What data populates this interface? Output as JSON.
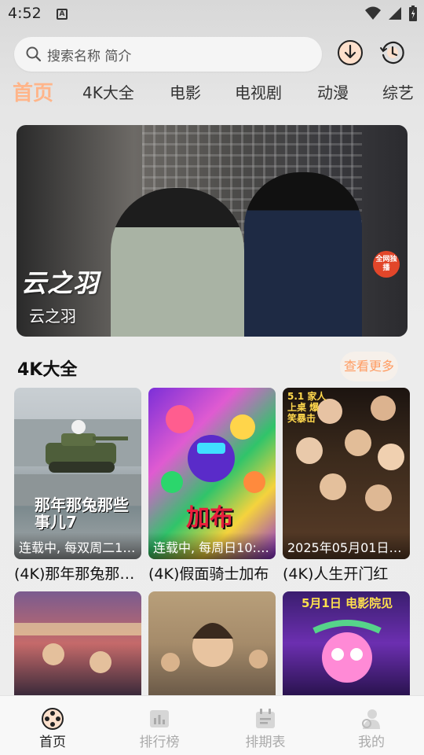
{
  "status_bar": {
    "time": "4:52",
    "notification_icon": "A"
  },
  "search": {
    "placeholder": "搜索名称 简介"
  },
  "header_icons": [
    "download-icon",
    "history-icon"
  ],
  "tabs": [
    {
      "label": "首页",
      "active": true
    },
    {
      "label": "4K大全"
    },
    {
      "label": "电影"
    },
    {
      "label": "电视剧"
    },
    {
      "label": "动漫"
    },
    {
      "label": "综艺"
    }
  ],
  "banner": {
    "poster_title": "云之羽",
    "caption": "云之羽",
    "badge": "全网独播"
  },
  "section": {
    "title": "4K大全",
    "more_label": "查看更多"
  },
  "cards": [
    {
      "status": "连载中, 每双周二1…",
      "title": "(4K)那年那兔那…",
      "poster_text": "那年那兔那些事儿7"
    },
    {
      "status": "连载中, 每周日10:…",
      "title": "(4K)假面骑士加布",
      "poster_text": "加布"
    },
    {
      "status": "2025年05月01日…",
      "title": "(4K)人生开门红",
      "poster_text": "5.1 家人上桌 爆笑暴击"
    },
    {
      "status": "",
      "title": "",
      "poster_text": ""
    },
    {
      "status": "",
      "title": "",
      "poster_text": ""
    },
    {
      "status": "",
      "title": "",
      "poster_text": "5月1日 电影院见"
    }
  ],
  "bottom_nav": [
    {
      "label": "首页",
      "icon": "film-reel-icon",
      "active": true
    },
    {
      "label": "排行榜",
      "icon": "chart-icon"
    },
    {
      "label": "排期表",
      "icon": "calendar-icon"
    },
    {
      "label": "我的",
      "icon": "user-icon"
    }
  ],
  "colors": {
    "accent": "#ffb58a",
    "more_text": "#ff9c62"
  }
}
